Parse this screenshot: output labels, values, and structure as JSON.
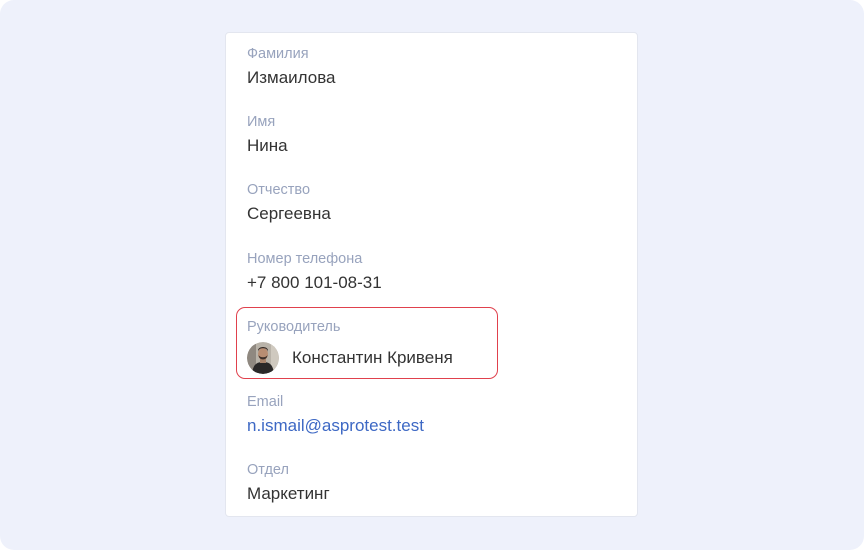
{
  "profile": {
    "last_name": {
      "label": "Фамилия",
      "value": "Измаилова"
    },
    "first_name": {
      "label": "Имя",
      "value": "Нина"
    },
    "patronymic": {
      "label": "Отчество",
      "value": "Сергеевна"
    },
    "phone": {
      "label": "Номер телефона",
      "value": "+7 800 101-08-31"
    },
    "manager": {
      "label": "Руководитель",
      "name": "Константин Кривеня",
      "avatar_icon": "user-avatar-photo"
    },
    "email": {
      "label": "Email",
      "value": "n.ismail@asprotest.test"
    },
    "department": {
      "label": "Отдел",
      "value": "Маркетинг"
    }
  },
  "colors": {
    "background": "#eef1fb",
    "label": "#98a3bd",
    "value": "#333333",
    "link": "#3d68c4",
    "highlight_border": "#e0414d"
  }
}
